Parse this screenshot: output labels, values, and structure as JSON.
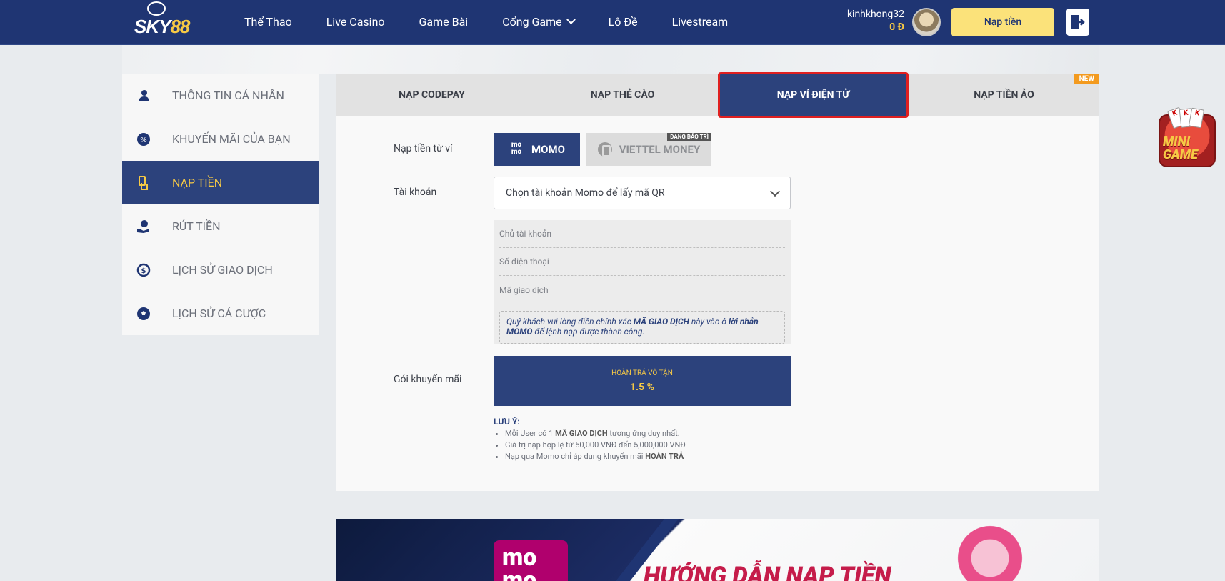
{
  "brand": {
    "logo_text": "SKY",
    "logo_num": "88"
  },
  "nav": {
    "items": [
      {
        "label": "Thể Thao"
      },
      {
        "label": "Live Casino"
      },
      {
        "label": "Game Bài"
      },
      {
        "label": "Cổng Game",
        "has_dropdown": true
      },
      {
        "label": "Lô Đề"
      },
      {
        "label": "Livestream"
      }
    ]
  },
  "user": {
    "username": "kinhkhong32",
    "balance": "0 Đ"
  },
  "header": {
    "deposit_label": "Nạp tiền",
    "logout_icon": "logout-icon"
  },
  "sidebar": {
    "items": [
      {
        "label": "THÔNG TIN CÁ NHÂN",
        "icon": "user-icon"
      },
      {
        "label": "KHUYẾN MÃI CỦA BẠN",
        "icon": "promo-badge-icon"
      },
      {
        "label": "NẠP TIỀN",
        "icon": "deposit-hand-icon",
        "active": true
      },
      {
        "label": "RÚT TIỀN",
        "icon": "withdraw-hand-icon"
      },
      {
        "label": "LỊCH SỬ GIAO DỊCH",
        "icon": "dollar-history-icon"
      },
      {
        "label": "LỊCH SỬ CÁ CƯỢC",
        "icon": "soccer-ball-icon"
      }
    ]
  },
  "tabs": [
    {
      "label": "NẠP CODEPAY"
    },
    {
      "label": "NẠP THẺ CÀO"
    },
    {
      "label": "NẠP VÍ ĐIỆN TỬ",
      "active": true
    },
    {
      "label": "NẠP TIỀN ẢO",
      "badge": "NEW"
    }
  ],
  "form": {
    "wallet_label": "Nạp tiền từ ví",
    "wallets": [
      {
        "label": "MOMO",
        "logo": "mo mo",
        "selected": true
      },
      {
        "label": "VIETTEL MONEY",
        "badge": "ĐANG BẢO TRÌ",
        "disabled": true
      }
    ],
    "account_label": "Tài khoản",
    "account_select_value": "Chọn tài khoản Momo để lấy mã QR",
    "fields": {
      "owner": "Chủ tài khoản",
      "phone": "Số điện thoại",
      "transaction_code": "Mã giao dịch"
    },
    "note": {
      "part1": "Quý khách vui lòng điền chính xác ",
      "bold1": "MÃ GIAO DỊCH",
      "part2": " này vào ô ",
      "bold2": "lời nhắn MOMO",
      "part3": " để lệnh nạp được thành công."
    },
    "promo_label": "Gói khuyến mãi",
    "promo_title": "HOÀN TRẢ VÔ TẬN",
    "promo_value": "1.5 %"
  },
  "notes": {
    "title": "LƯU Ý:",
    "items": [
      {
        "pre": "Mỗi User có 1 ",
        "bold": "MÃ GIAO DỊCH",
        "post": " tương ứng duy nhất."
      },
      {
        "pre": "Giá trị nạp hợp lệ từ 50,000 VNĐ đến 5,000,000 VNĐ.",
        "bold": "",
        "post": ""
      },
      {
        "pre": "Nạp qua Momo chỉ áp dụng khuyến mãi ",
        "bold": "HOÀN TRẢ",
        "post": ""
      }
    ]
  },
  "banner": {
    "momo_logo": "mo mo",
    "title": "HƯỚNG DẪN NẠP TIỀN"
  },
  "minigame": {
    "text_line1": "MINI",
    "text_line2": "GAME"
  },
  "colors": {
    "header_bg": "#1f3573",
    "accent_yellow": "#f6c945",
    "active_bg": "#2c427c",
    "highlight_border": "#e02020",
    "new_badge": "#f39a1e"
  }
}
